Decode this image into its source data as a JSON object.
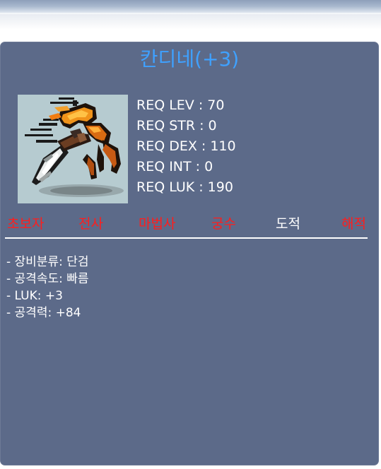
{
  "item": {
    "name": "칸디네(+3)"
  },
  "requirements": [
    "REQ LEV : 70",
    "REQ STR : 0",
    "REQ DEX : 110",
    "REQ INT : 0",
    "REQ LUK : 190"
  ],
  "jobs": [
    {
      "label": "초보자",
      "active": false
    },
    {
      "label": "전사",
      "active": false
    },
    {
      "label": "마법사",
      "active": false
    },
    {
      "label": "궁수",
      "active": false
    },
    {
      "label": "도적",
      "active": true
    },
    {
      "label": "해적",
      "active": false
    }
  ],
  "stats": [
    "- 장비분류: 단검",
    "- 공격속도: 빠름",
    "- LUK: +3",
    "- 공격력: +84"
  ],
  "colors": {
    "panel_bg": "#5c6a89",
    "title": "#3fa1ff",
    "job_available": "#ffffff",
    "job_unavailable": "#ff1d1d",
    "icon_bg": "#b6cbd0"
  },
  "icons": {
    "item": "dagger-item-icon"
  }
}
